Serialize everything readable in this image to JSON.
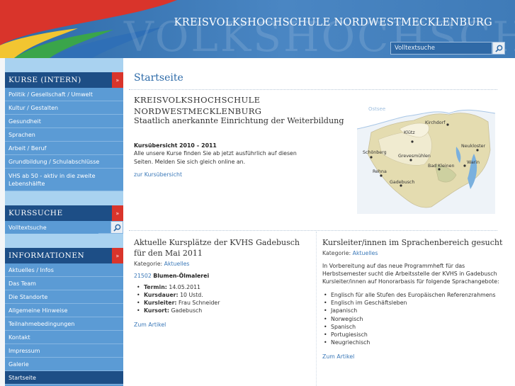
{
  "header": {
    "title": "KREISVOLKSHOCHSCHULE NORDWESTMECKLENBURG",
    "background_text": "VOLKSHOCHSCHULE",
    "search_placeholder": "Volltextsuche",
    "colors": {
      "header_blue": "#3f7bb8",
      "swoosh_red": "#d9342b",
      "swoosh_yellow": "#f2c531",
      "swoosh_green": "#3aa54a"
    }
  },
  "sidebar": {
    "courses_header": "KURSE (INTERN)",
    "courses": [
      "Politik / Gesellschaft / Umwelt",
      "Kultur / Gestalten",
      "Gesundheit",
      "Sprachen",
      "Arbeit / Beruf",
      "Grundbildung / Schulabschlüsse",
      "VHS ab 50 - aktiv in die zweite Lebenshälfte"
    ],
    "search_header": "KURSSUCHE",
    "search_placeholder": "Volltextsuche",
    "info_header": "INFORMATIONEN",
    "info_items": [
      "Aktuelles / Infos",
      "Das Team",
      "Die Standorte",
      "Allgemeine Hinweise",
      "Teilnahmebedingungen",
      "Kontakt",
      "Impressum",
      "Galerie",
      "Startseite"
    ]
  },
  "main": {
    "page_title": "Startseite",
    "org_line1": "KREISVOLKSHOCHSCHULE",
    "org_line2": "NORDWESTMECKLENBURG",
    "org_sub": "Staatlich anerkannte Einrichtung der Weiterbildung",
    "overview_title": "Kursübersicht 2010 – 2011",
    "overview_text": "Alle unsere Kurse finden Sie ab jetzt ausführlich auf diesen Seiten. Melden Sie sich gleich online an.",
    "overview_link": "zur Kursübersicht",
    "map": {
      "sea_label": "Ostsee",
      "towns": [
        "Kirchdorf",
        "Klütz",
        "Neukloster",
        "Schönberg",
        "Grevesmühlen",
        "Warin",
        "Bad Kleinen",
        "Rehna",
        "Gadebusch"
      ]
    }
  },
  "article1": {
    "title": "Aktuelle Kursplätze der KVHS Gadebusch für den Mai 2011",
    "category_label": "Kategorie:",
    "category_value": "Aktuelles",
    "course_number": "21502",
    "course_name": "Blumen-Ölmalerei",
    "facts": [
      {
        "label": "Termin:",
        "value": "14.05.2011"
      },
      {
        "label": "Kursdauer:",
        "value": "10 Ustd."
      },
      {
        "label": "Kursleiter:",
        "value": "Frau Schneider"
      },
      {
        "label": "Kursort:",
        "value": "Gadebusch"
      }
    ],
    "link": "Zum Artikel"
  },
  "article2": {
    "title": "Kursleiter/innen im Sprachenbereich gesucht",
    "category_label": "Kategorie:",
    "category_value": "Aktuelles",
    "text": "In Vorbereitung auf das neue Programmheft für das Herbstsemester sucht die Arbeitsstelle der KVHS in Gadebusch Kursleiter/innen auf Honorarbasis für folgende Sprachangebote:",
    "languages": [
      "Englisch für alle Stufen des Europäischen Referenzrahmens",
      "Englisch im Geschäftsleben",
      "Japanisch",
      "Norwegisch",
      "Spanisch",
      "Portugiesisch",
      "Neugriechisch"
    ],
    "link": "Zum Artikel"
  }
}
